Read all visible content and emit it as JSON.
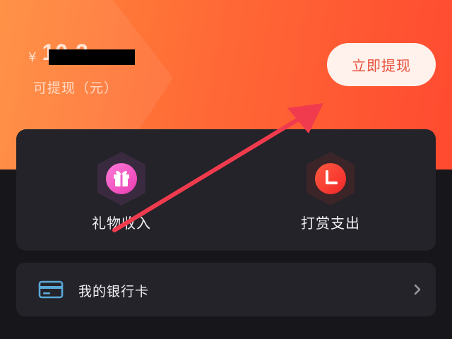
{
  "balance": {
    "currency_symbol": "¥",
    "amount": "10.2",
    "caption": "可提现（元）"
  },
  "actions": {
    "withdraw_label": "立即提现"
  },
  "quick_items": [
    {
      "label": "礼物收入",
      "icon": "gift-icon"
    },
    {
      "label": "打赏支出",
      "icon": "clock-icon"
    }
  ],
  "bank": {
    "label": "我的银行卡",
    "icon": "bank-card-icon"
  },
  "colors": {
    "hero_start": "#ff8a3a",
    "hero_end": "#ff4a30",
    "card_bg": "#232329",
    "page_bg": "#17171b",
    "accent_pink": "#ff4fc0",
    "accent_red": "#ff3b2f",
    "annotation_arrow": "#f03b4e"
  }
}
